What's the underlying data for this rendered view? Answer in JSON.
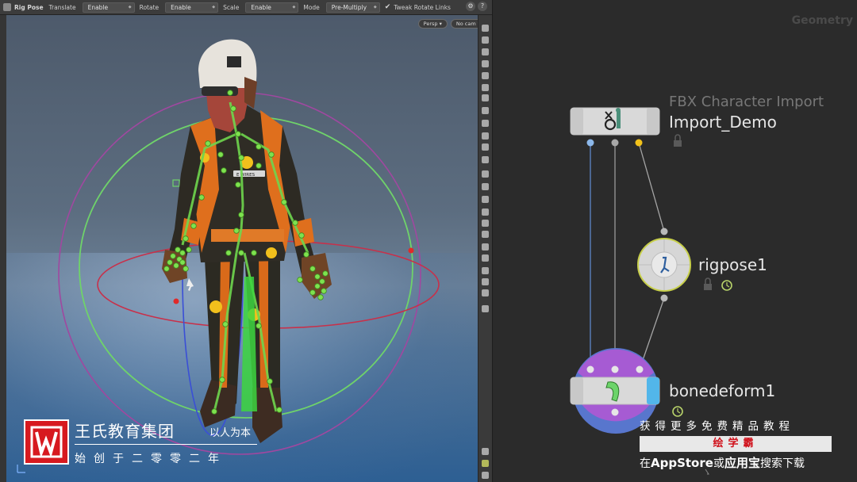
{
  "viewport": {
    "toolbar": {
      "tool_title": "Rig Pose",
      "translate_label": "Translate",
      "translate_value": "Enable",
      "rotate_label": "Rotate",
      "rotate_value": "Enable",
      "scale_label": "Scale",
      "scale_value": "Enable",
      "mode_label": "Mode",
      "mode_value": "Pre-Multiply",
      "tweak_label": "Tweak Rotate Links"
    },
    "camera_menu": {
      "persp": "Persp ▾",
      "cam": "No cam ▾"
    },
    "suit_logo": "E WIRES"
  },
  "network": {
    "context_label": "Geometry",
    "nodes": [
      {
        "id": "import",
        "type": "FBX Character Import",
        "name": "Import_Demo"
      },
      {
        "id": "rigpose",
        "type": "",
        "name": "rigpose1"
      },
      {
        "id": "bonedeform",
        "type": "",
        "name": "bonedeform1"
      }
    ]
  },
  "overlay": {
    "brand_name": "王氏教育集团",
    "brand_slogan": "以人为本",
    "brand_since": "始创于二零零二年",
    "promo_line1": "获得更多免费精品教程",
    "promo_bar": "绘学霸",
    "promo_line3_a": "在",
    "promo_line3_b": "AppStore",
    "promo_line3_c": "或",
    "promo_line3_d": "应用宝",
    "promo_line3_e": "搜索下载"
  },
  "colors": {
    "suit_orange": "#e0701e",
    "guide_green": "#7bd65a",
    "node_blue": "#88b6ea",
    "node_purple": "#a25cd1",
    "node_yellow": "#f2c21a",
    "watermark_red": "#d7191f"
  }
}
